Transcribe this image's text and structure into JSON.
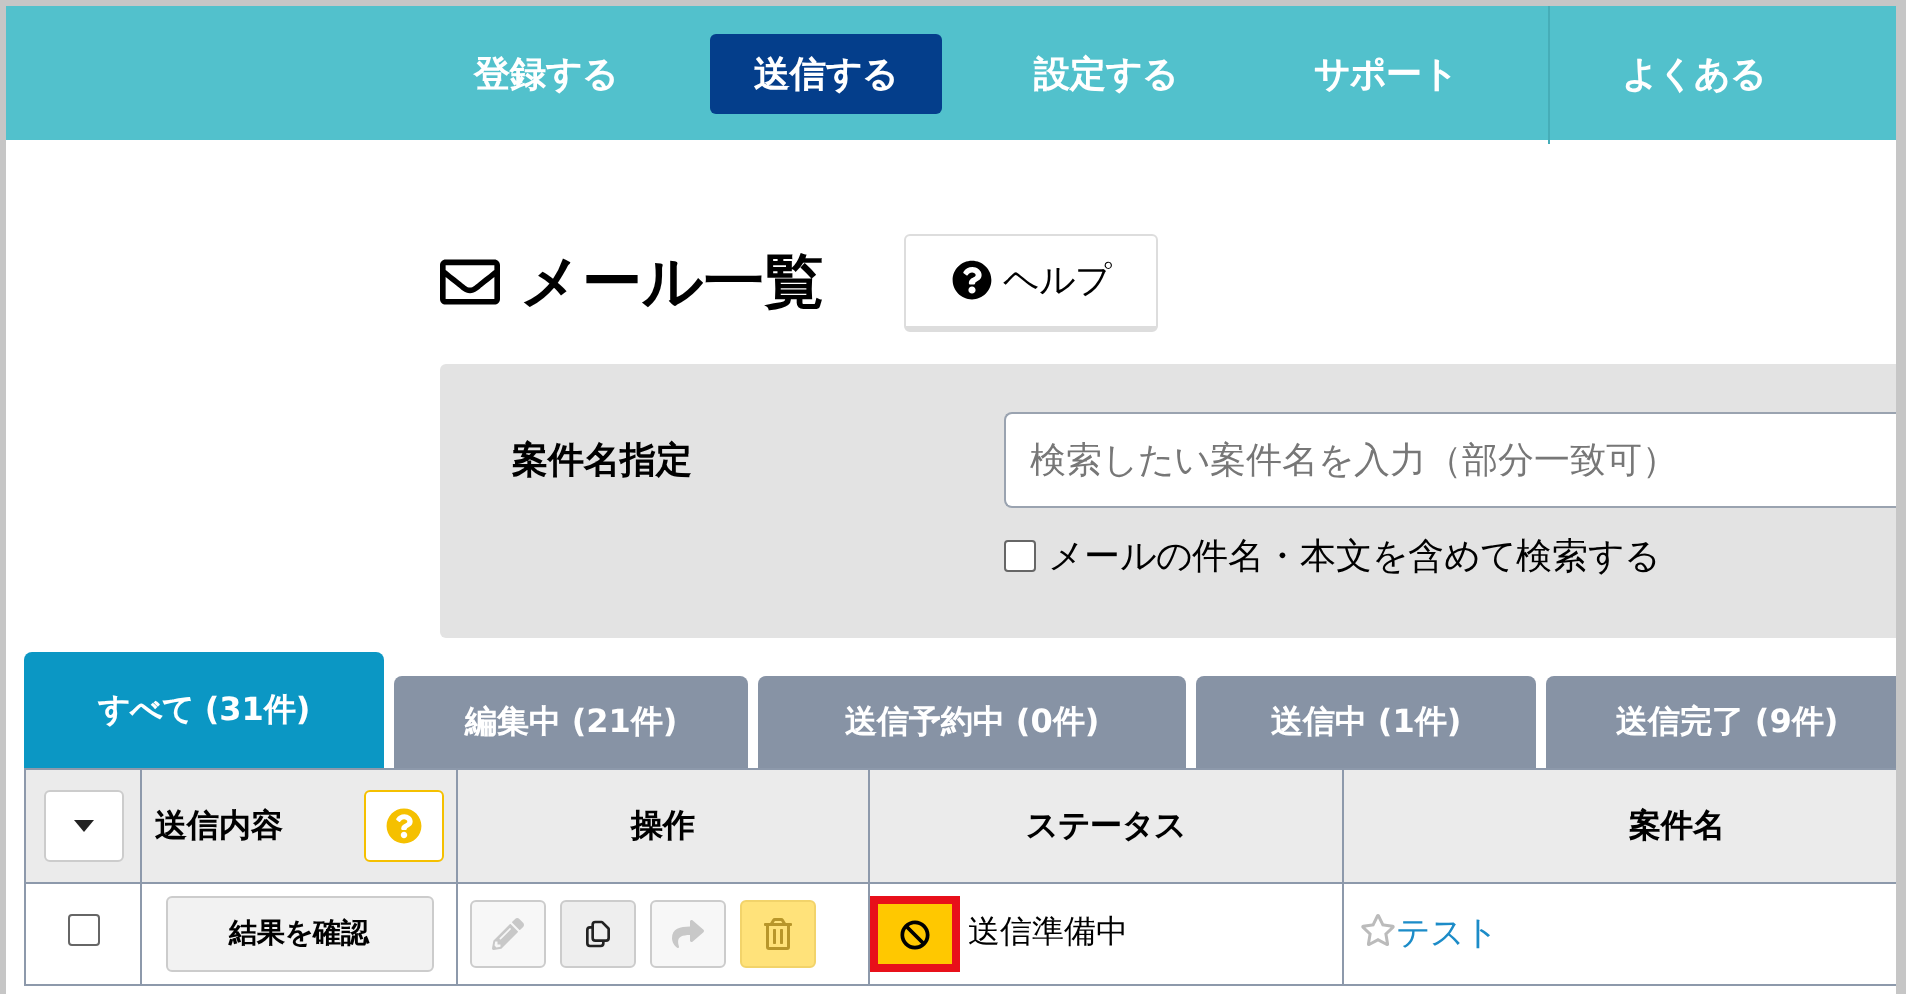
{
  "nav": [
    {
      "label": "登録する",
      "selected": false
    },
    {
      "label": "送信する",
      "selected": true
    },
    {
      "label": "設定する",
      "selected": false
    },
    {
      "label": "サポート",
      "selected": false
    },
    {
      "label": "よくある",
      "selected": false
    }
  ],
  "title": "メール一覧",
  "help_button": "ヘルプ",
  "search": {
    "label": "案件名指定",
    "placeholder": "検索したい案件名を入力（部分一致可）",
    "option": {
      "label": "メールの件名・本文を含めて検索する",
      "checked": false
    }
  },
  "tabs": [
    {
      "label": "すべて (31件)",
      "selected": true
    },
    {
      "label": "編集中 (21件)",
      "selected": false
    },
    {
      "label": "送信予約中 (0件)",
      "selected": false
    },
    {
      "label": "送信中 (1件)",
      "selected": false
    },
    {
      "label": "送信完了 (9件)",
      "selected": false
    }
  ],
  "table": {
    "columns": [
      "送信内容",
      "操作",
      "ステータス",
      "案件名"
    ],
    "rows": [
      {
        "checked": false,
        "result_button": "結果を確認",
        "actions": [
          {
            "kind": "edit",
            "disabled": true
          },
          {
            "kind": "copy",
            "disabled": false
          },
          {
            "kind": "forward",
            "disabled": true
          },
          {
            "kind": "delete",
            "disabled": true
          }
        ],
        "status": "送信準備中",
        "starred": false,
        "name": "テスト"
      }
    ]
  }
}
